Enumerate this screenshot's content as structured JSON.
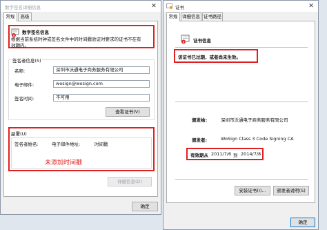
{
  "left_window": {
    "title": "数字签名详细信息",
    "tabs": [
      "常规",
      "高级"
    ],
    "info": {
      "heading": "数字签名信息",
      "line1": "根据当前系统时钟或签名文件中的时间戳验证时要求的证书不在有",
      "line2": "效期内。"
    },
    "signer_info": {
      "section_title": "签名者信息(S)",
      "name_label": "名称:",
      "name_value": "深圳市沃通电子商务服务有限公司",
      "email_label": "电子邮件:",
      "email_value": "wosign@wosign.com",
      "time_label": "签名时间:",
      "time_value": "不可用",
      "view_cert_button": "查看证书(V)"
    },
    "countersig": {
      "title": "副署(U)",
      "columns": [
        "签名者姓名:",
        "电子邮件地址:",
        "时间戳"
      ],
      "annotation": "未添加时间戳",
      "details_button": "详细信息(D)"
    },
    "ok_button": "确定"
  },
  "right_window": {
    "title": "证书",
    "tabs": [
      "常规",
      "详细信息",
      "证书路径"
    ],
    "cert_info_heading": "证书信息",
    "warning": "该证书已过期，或者尚未生效。",
    "issued_to_label": "颁发给:",
    "issued_to_value": "深圳市沃通电子商务服务有限公司",
    "issued_by_label": "颁发者:",
    "issued_by_value": "WoSign Class 3 Code Signing CA",
    "validity_label": "有效期从",
    "validity_from": "2011/7/6",
    "validity_to_word": "到",
    "validity_to": "2014/7/8",
    "install_button": "安装证书(I)...",
    "issuer_statement_button": "颁发者说明(S)",
    "ok_button": "确定"
  },
  "colors": {
    "highlight_border": "#e02020",
    "annotation_text": "#e02020",
    "primary_button_border": "#0078d7"
  },
  "icons": [
    "certificate-icon",
    "certificate-error-icon",
    "close-icon"
  ]
}
